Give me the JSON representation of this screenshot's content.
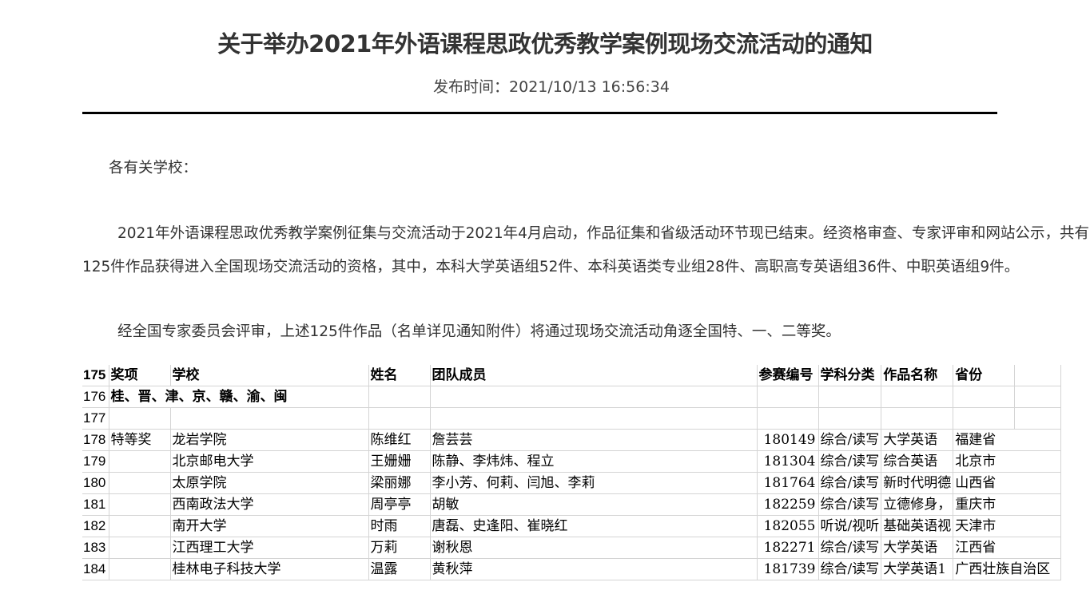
{
  "notice": {
    "title": "关于举办2021年外语课程思政优秀教学案例现场交流活动的通知",
    "publish_time": "发布时间：2021/10/13 16:56:34",
    "greeting": "各有关学校：",
    "paragraph1_line1": "2021年外语课程思政优秀教学案例征集与交流活动于2021年4月启动，作品征集和省级活动环节现已结束。经资格审查、专家评审和网站公示，共有",
    "paragraph1_line2": "125件作品获得进入全国现场交流活动的资格，其中，本科大学英语组52件、本科英语类专业组28件、高职高专英语组36件、中职英语组9件。",
    "paragraph2": "经全国专家委员会评审，上述125件作品（名单详见通知附件）将通过现场交流活动角逐全国特、一、二等奖。"
  },
  "sheet": {
    "header": {
      "row": "175",
      "award": "奖项",
      "school": "学校",
      "name": "姓名",
      "team": "团队成员",
      "code": "参赛编号",
      "category": "学科分类",
      "work": "作品名称",
      "province": "省份"
    },
    "group_row": {
      "row": "176",
      "label": "桂、晋、津、京、赣、渝、闽"
    },
    "empty_row": {
      "row": "177"
    },
    "rows": [
      {
        "row": "178",
        "award": "特等奖",
        "school": "龙岩学院",
        "name": "陈维红",
        "team": "詹芸芸",
        "code": "180149",
        "category": "综合/读写",
        "work": "大学英语",
        "province": "福建省"
      },
      {
        "row": "179",
        "award": "",
        "school": "北京邮电大学",
        "name": "王姗姗",
        "team": "陈静、李炜炜、程立",
        "code": "181304",
        "category": "综合/读写",
        "work": "综合英语",
        "province": "北京市"
      },
      {
        "row": "180",
        "award": "",
        "school": "太原学院",
        "name": "梁丽娜",
        "team": "李小芳、何莉、闫旭、李莉",
        "code": "181764",
        "category": "综合/读写",
        "work": "新时代明德",
        "province": "山西省"
      },
      {
        "row": "181",
        "award": "",
        "school": "西南政法大学",
        "name": "周亭亭",
        "team": "胡敏",
        "code": "182259",
        "category": "综合/读写",
        "work": "立德修身，",
        "province": "重庆市"
      },
      {
        "row": "182",
        "award": "",
        "school": "南开大学",
        "name": "时雨",
        "team": "唐磊、史逢阳、崔晓红",
        "code": "182055",
        "category": "听说/视听",
        "work": "基础英语视",
        "province": "天津市"
      },
      {
        "row": "183",
        "award": "",
        "school": "江西理工大学",
        "name": "万莉",
        "team": "谢秋恩",
        "code": "182271",
        "category": "综合/读写",
        "work": "大学英语",
        "province": "江西省"
      },
      {
        "row": "184",
        "award": "",
        "school": "桂林电子科技大学",
        "name": "温露",
        "team": "黄秋萍",
        "code": "181739",
        "category": "综合/读写",
        "work": "大学英语1",
        "province": "广西壮族自治区"
      }
    ]
  }
}
